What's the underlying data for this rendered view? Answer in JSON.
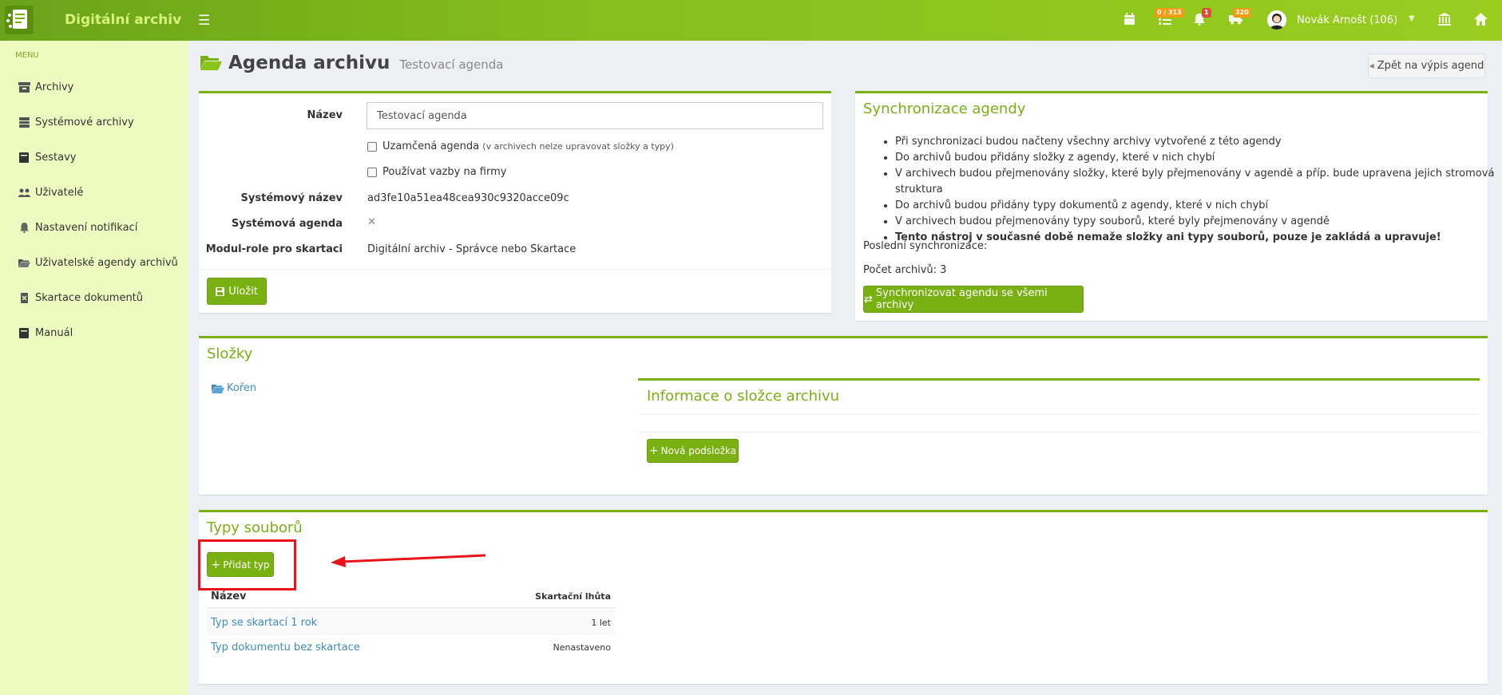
{
  "app": {
    "title": "Digitální archiv"
  },
  "topbar": {
    "tasks_badge": "0 / 313",
    "notif_badge": "1",
    "truck_badge": "320",
    "user": "Novák Arnošt (106)"
  },
  "sidebar": {
    "header": "MENU",
    "items": [
      {
        "label": "Archivy",
        "icon": "archive-icon"
      },
      {
        "label": "Systémové archivy",
        "icon": "database-icon"
      },
      {
        "label": "Sestavy",
        "icon": "book-icon"
      },
      {
        "label": "Uživatelé",
        "icon": "users-icon"
      },
      {
        "label": "Nastavení notifikací",
        "icon": "bell-icon"
      },
      {
        "label": "Uživatelské agendy archivů",
        "icon": "folder-open-icon"
      },
      {
        "label": "Skartace dokumentů",
        "icon": "trash-icon"
      },
      {
        "label": "Manuál",
        "icon": "book-icon"
      }
    ]
  },
  "page": {
    "title": "Agenda archivu",
    "subtitle": "Testovací agenda",
    "back": "Zpět na výpis agend"
  },
  "form": {
    "name_label": "Název",
    "name_value": "Testovací agenda",
    "locked_label": "Uzamčená agenda",
    "locked_note": "(v archivech nelze upravovat složky a typy)",
    "firms_label": "Používat vazby na firmy",
    "sysname_label": "Systémový název",
    "sysname_value": "ad3fe10a51ea48cea930c9320acce09c",
    "sysagenda_label": "Systémová agenda",
    "sysagenda_value": "✕",
    "role_label": "Modul-role pro skartaci",
    "role_value": "Digitální archiv - Správce nebo Skartace",
    "save": "Uložit"
  },
  "sync": {
    "title": "Synchronizace agendy",
    "items": [
      "Při synchronizaci budou načteny všechny archivy vytvořené z této agendy",
      "Do archivů budou přidány složky z agendy, které v nich chybí",
      "V archivech budou přejmenovány složky, které byly přejmenovány v agendě a příp. bude upravena jejich stromová struktura",
      "Do archivů budou přidány typy dokumentů z agendy, které v nich chybí",
      "V archivech budou přejmenovány typy souborů, které byly přejmenovány v agendě",
      "Tento nástroj v současné době nemaže složky ani typy souborů, pouze je zakládá a upravuje!"
    ],
    "last_sync": "Poslední synchronizace:",
    "count": "Počet archivů: 3",
    "button": "Synchronizovat agendu se všemi archivy"
  },
  "folders": {
    "title": "Složky",
    "root": "Kořen",
    "info_title": "Informace o složce archivu",
    "new_button": "Nová podsložka"
  },
  "types": {
    "title": "Typy souborů",
    "add_button": "Přidat typ",
    "col_name": "Název",
    "col_period": "Skartační lhůta",
    "rows": [
      {
        "name": "Typ se skartací 1 rok",
        "period": "1 let"
      },
      {
        "name": "Typ dokumentu bez skartace",
        "period": "Nenastaveno"
      }
    ]
  },
  "colors": {
    "brand": "#79b012",
    "sidebar": "#eefbc0",
    "annotation": "#e8141a"
  }
}
